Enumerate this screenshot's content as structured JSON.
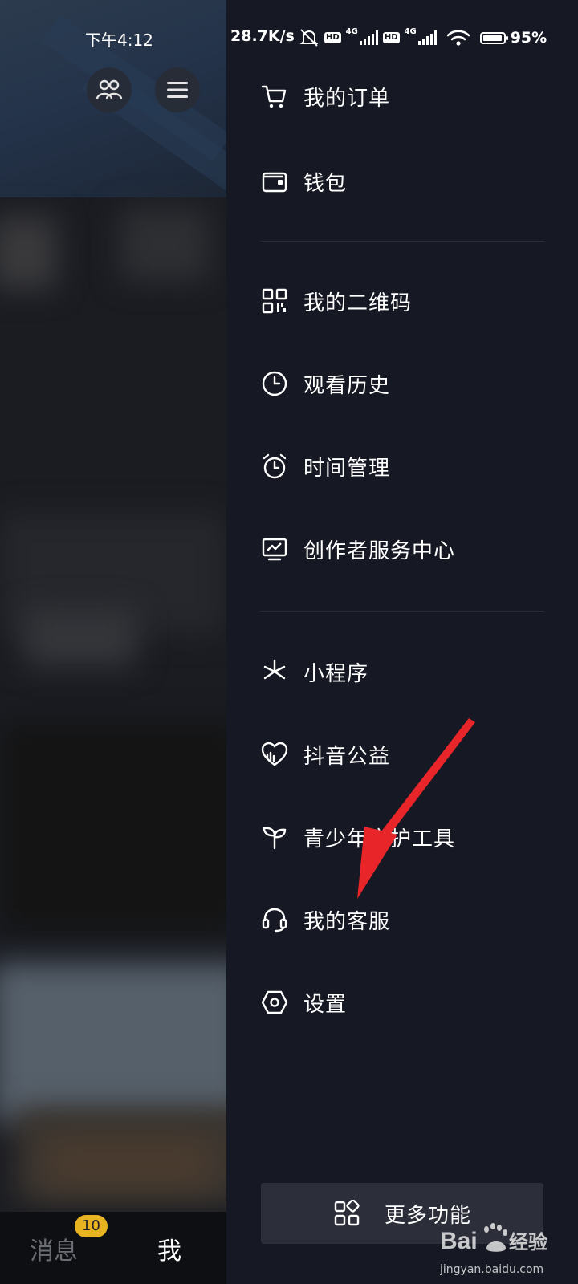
{
  "status_bar": {
    "time": "下午4:12",
    "net_speed": "28.7K/s",
    "hd1": "HD",
    "net1": "4G",
    "hd2": "HD",
    "net2": "4G",
    "battery_pct": "95%",
    "battery_level": 0.95
  },
  "drawer": {
    "group1": [
      {
        "label": "我的订单",
        "icon": "cart-icon"
      },
      {
        "label": "钱包",
        "icon": "wallet-icon"
      }
    ],
    "group2": [
      {
        "label": "我的二维码",
        "icon": "qr-code-icon"
      },
      {
        "label": "观看历史",
        "icon": "clock-icon"
      },
      {
        "label": "时间管理",
        "icon": "alarm-clock-icon"
      },
      {
        "label": "创作者服务中心",
        "icon": "chart-monitor-icon"
      }
    ],
    "group3": [
      {
        "label": "小程序",
        "icon": "mini-program-icon"
      },
      {
        "label": "抖音公益",
        "icon": "charity-heart-icon"
      },
      {
        "label": "青少年守护工具",
        "icon": "sprout-icon"
      },
      {
        "label": "我的客服",
        "icon": "headset-icon"
      },
      {
        "label": "设置",
        "icon": "hexagon-settings-icon"
      }
    ],
    "more_label": "更多功能"
  },
  "bottom_nav": {
    "messages_label": "消息",
    "messages_badge": "10",
    "me_label": "我"
  },
  "watermark": {
    "brand": "Bai",
    "brand2": "经验",
    "url": "jingyan.baidu.com"
  },
  "colors": {
    "drawer_bg": "#161823",
    "more_button_bg": "#2c2f3a",
    "badge": "#e8b320",
    "arrow": "#e8262a"
  }
}
